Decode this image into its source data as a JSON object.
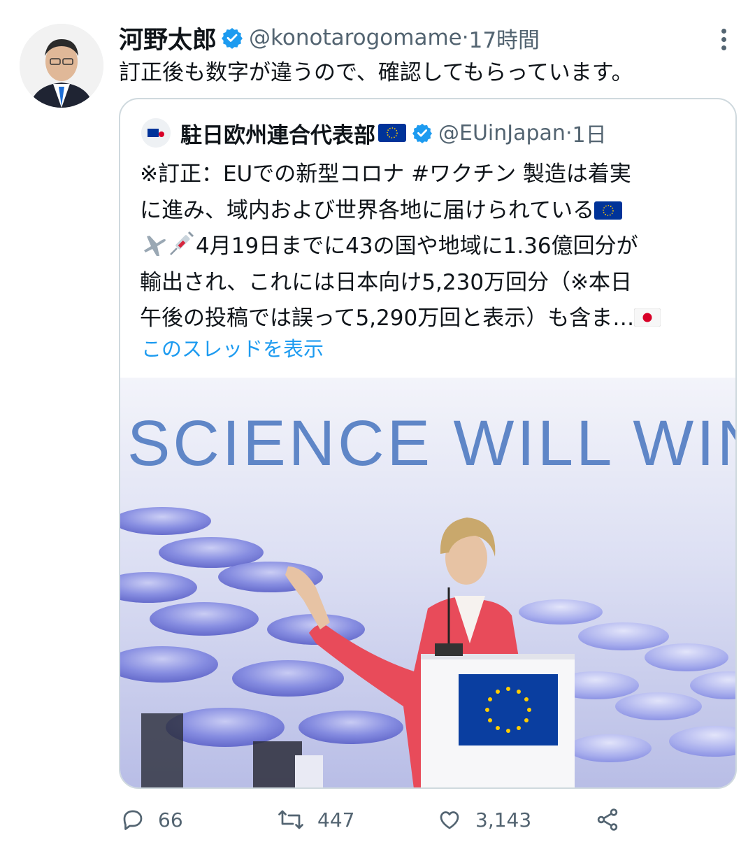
{
  "tweet": {
    "author_name": "河野太郎",
    "handle": "@konotarogomame",
    "time": "17時間",
    "separator": " · ",
    "text": "訂正後も数字が違うので、確認してもらっています。"
  },
  "quote": {
    "author_name": "駐日欧州連合代表部",
    "handle": "@EUinJapan",
    "time": "1日",
    "lines": [
      "※訂正：EUでの新型コロナ #ワクチン 製造は着実",
      "に進み、域内および世界各地に届けられている",
      "4月19日までに43の国や地域に1.36億回分が",
      "輸出され、これには日本向け5,230万回分（※本日",
      "午後の投稿では誤って5,290万回と表示）も含ま…"
    ],
    "show_thread": "このスレッドを表示",
    "media_text": "SCIENCE WILL WIN"
  },
  "actions": {
    "replies": "66",
    "retweets": "447",
    "likes": "3,143"
  },
  "colors": {
    "accent": "#1d9bf0",
    "muted": "#536471",
    "eu_blue": "#003399",
    "eu_gold": "#ffcc00",
    "jacket": "#e84b5a"
  },
  "icons": [
    "verified-badge-icon",
    "more-options-icon",
    "reply-icon",
    "retweet-icon",
    "like-icon",
    "share-icon",
    "eu-flag-icon",
    "japan-flag-icon",
    "airplane-icon",
    "syringe-icon"
  ]
}
